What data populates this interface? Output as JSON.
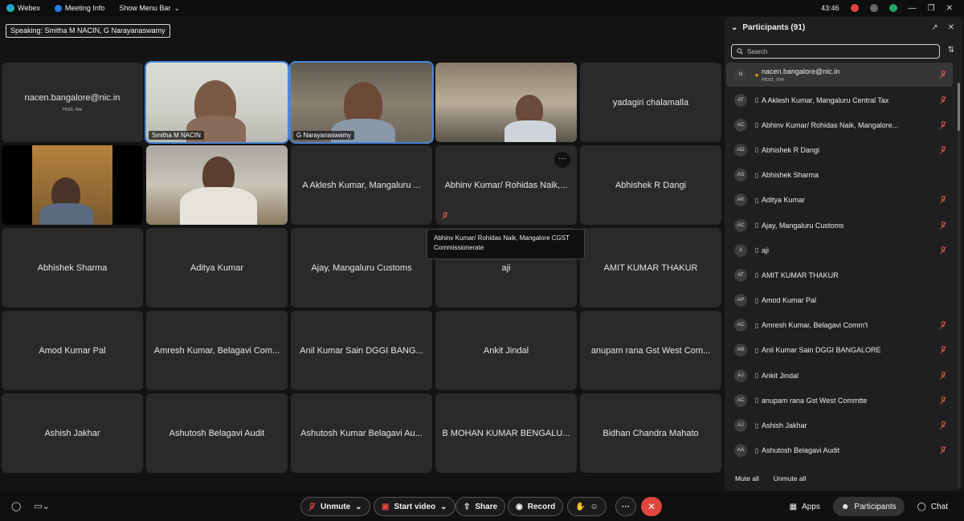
{
  "titlebar": {
    "app_name": "Webex",
    "meeting_info": "Meeting Info",
    "show_menu_bar": "Show Menu Bar",
    "timer": "43:46"
  },
  "speaking": "Speaking: Smitha M NACIN, G Narayanaswamy",
  "grid": {
    "host_tile": {
      "name": "nacen.bangalore@nic.in",
      "sub": "Host, me"
    },
    "video_labels": [
      "Smitha M NACIN",
      "G Narayanaswamy"
    ],
    "names": [
      "yadagiri chalamalla",
      "A Aklesh Kumar, Mangaluru ...",
      "Abhinv Kumar/ Rohidas Naik,...",
      "Abhishek R Dangi",
      "Abhishek Sharma",
      "Aditya Kumar",
      "Ajay, Mangaluru Customs",
      "aji",
      "AMIT KUMAR THAKUR",
      "Amod Kumar Pal",
      "Amresh Kumar, Belagavi Com...",
      "Anil Kumar Sain DGGI BANG...",
      "Ankit Jindal",
      "anupam rana Gst West Com...",
      "Ashish Jakhar",
      "Ashutosh Belagavi Audit",
      "Ashutosh Kumar Belagavi Au...",
      "B MOHAN KUMAR BENGALU...",
      "Bidhan Chandra Mahato"
    ],
    "more_label": "···"
  },
  "tooltip": "Abhinv Kumar/ Rohidas Naik, Mangalore CGST Commissionerate",
  "panel": {
    "title": "Participants (91)",
    "search_placeholder": "Search",
    "self": {
      "avatar": "N",
      "name": "nacen.bangalore@nic.in",
      "sub": "Host, me"
    },
    "participants": [
      {
        "avatar": "AT",
        "name": "A Aklesh Kumar, Mangaluru Central Tax",
        "muted": true
      },
      {
        "avatar": "AC",
        "name": "Abhinv Kumar/ Rohidas Naik, Mangalore...",
        "muted": true
      },
      {
        "avatar": "AD",
        "name": "Abhishek R Dangi",
        "muted": true
      },
      {
        "avatar": "AS",
        "name": "Abhishek Sharma",
        "muted": false
      },
      {
        "avatar": "AK",
        "name": "Aditya Kumar",
        "muted": true
      },
      {
        "avatar": "AC",
        "name": "Ajay, Mangaluru Customs",
        "muted": true
      },
      {
        "avatar": "A",
        "name": "aji",
        "muted": true
      },
      {
        "avatar": "AT",
        "name": "AMIT KUMAR THAKUR",
        "muted": false
      },
      {
        "avatar": "AP",
        "name": "Amod Kumar Pal",
        "muted": false
      },
      {
        "avatar": "AC",
        "name": "Amresh Kumar, Belagavi Comm't",
        "muted": true
      },
      {
        "avatar": "AB",
        "name": "Anil Kumar Sain DGGI BANGALORE",
        "muted": true
      },
      {
        "avatar": "AJ",
        "name": "Ankit Jindal",
        "muted": true
      },
      {
        "avatar": "AC",
        "name": "anupam rana Gst West Commtte",
        "muted": true
      },
      {
        "avatar": "AJ",
        "name": "Ashish Jakhar",
        "muted": true
      },
      {
        "avatar": "AA",
        "name": "Ashutosh Belagavi Audit",
        "muted": true
      }
    ],
    "mute_all": "Mute all",
    "unmute_all": "Unmute all"
  },
  "bottombar": {
    "unmute": "Unmute",
    "start_video": "Start video",
    "share": "Share",
    "record": "Record",
    "apps": "Apps",
    "participants": "Participants",
    "chat": "Chat"
  },
  "colors": {
    "accent": "#4a86d8",
    "end_call": "#e0453e",
    "mute_red": "#d9534f"
  }
}
